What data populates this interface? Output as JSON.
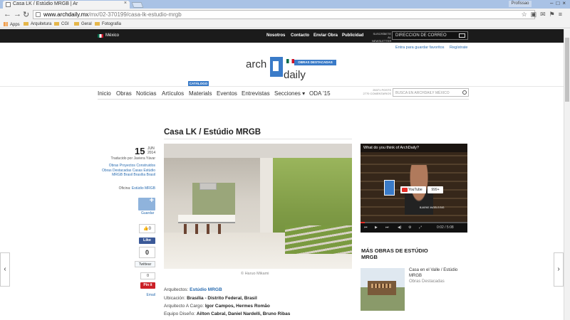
{
  "browser": {
    "tab_title": "Casa LK / Estúdio MRGB | Ar",
    "profile": "Profissao",
    "url_host": "www.archdaily.mx",
    "url_path": "/mx/02-370199/casa-lk-estudio-mrgb",
    "bookmarks": [
      "Apps",
      "Arquitetura",
      "CGI",
      "Geral",
      "Fotografia"
    ]
  },
  "topbar": {
    "country": "México",
    "links": [
      "Nosotros",
      "Contacto",
      "Enviar Obra",
      "Publicidad"
    ],
    "subscribe_label": "SUSCRÍBETE AL NEWSLETTER",
    "email_placeholder": "DIRECCION DE CORREO"
  },
  "account": {
    "login": "Entra para guardar favoritos",
    "register": "Regístrate"
  },
  "logo": {
    "arch": "arch",
    "daily": "daily",
    "badge": "OBRAS DESTACADAS"
  },
  "nav": {
    "badge": "CATÁLOGO",
    "items": [
      "Inicio",
      "Obras",
      "Noticias",
      "Artículos",
      "Materials",
      "Eventos",
      "Entrevistas",
      "Secciones ▾",
      "ODA '15"
    ],
    "posts_line1": "25371 POSTS",
    "posts_line2": "2770 COMENTARIOS",
    "search_placeholder": "BUSCA EN ARCHDAILY MÉXICO"
  },
  "article": {
    "title": "Casa LK / Estúdio MRGB",
    "day": "15",
    "month": "JUN",
    "year": "2014",
    "translated": "Traducido por Javiera Yávar",
    "tags": "Obras  Proyectos Construidos  Obras Destacadas  Casas  Estúdio MRGB  Brasil  Brasília  Brasil",
    "office_label": "Oficina:",
    "office": "Estúdio MRGB",
    "save_label": "Guardar",
    "like_count": "0",
    "fb_like": "Like",
    "share_count": "0",
    "tweet": "Twittear",
    "pin_count": "0",
    "pin": "Pin it",
    "email": "Email",
    "photo_credit": "© Haruo Mikami",
    "details": [
      {
        "label": "Arquitectos:",
        "value": "Estúdio MRGB"
      },
      {
        "label": "Ubicación:",
        "value": "Brasília - Distrito Federal, Brasil"
      },
      {
        "label": "Arquitecto A Cargo:",
        "value": "Igor Campos, Hermes Romão"
      },
      {
        "label": "Equipo Diseño:",
        "value": "Ailton Cabral, Daniel Nardelli, Bruno Ribas"
      }
    ]
  },
  "sidebar": {
    "video_title": "What do you think of ArchDaily?",
    "youtube": "YouTube",
    "yt_count": "999+",
    "name_card": "BJARKE INGELS BIG",
    "time": "0:02 / 5:08",
    "more_title": "MÁS OBRAS DE ESTÚDIO MRGB",
    "more_item_name": "Casa en el Valle / Estúdio MRGB",
    "more_item_cat": "Obras Destacadas"
  },
  "arrows": {
    "left": "‹",
    "right": "›"
  }
}
